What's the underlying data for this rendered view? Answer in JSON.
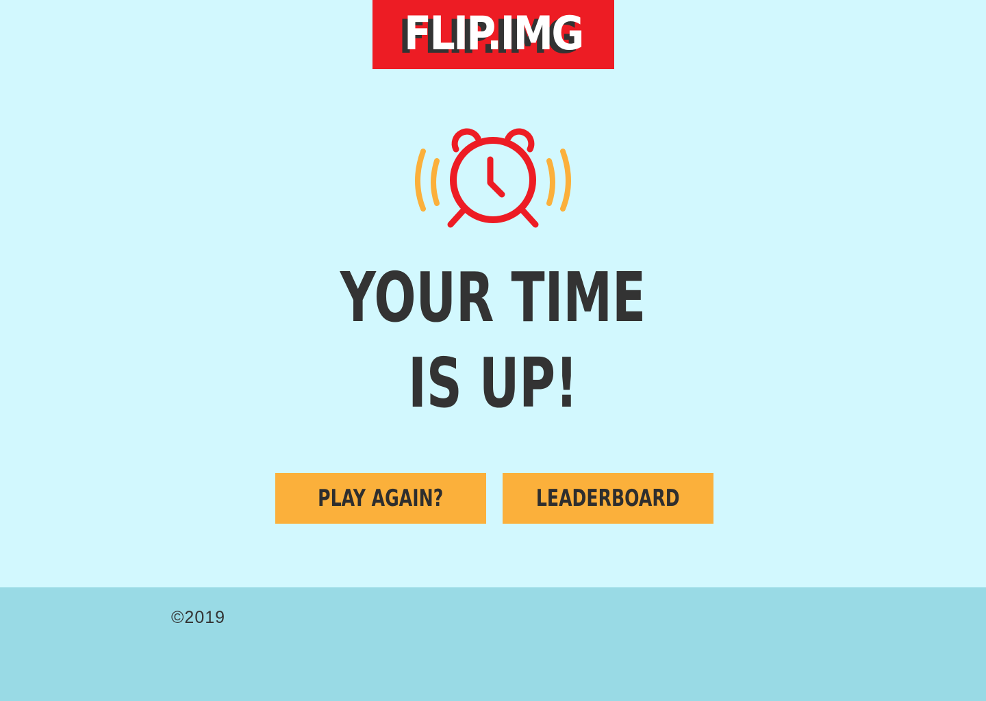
{
  "logo": {
    "text": "FLIP.IMG",
    "background": "#ed1c24"
  },
  "alarm": {
    "icon": "alarm-clock-icon",
    "clock_color": "#ed1c24",
    "ring_color": "#fbb03b"
  },
  "headline": {
    "line1": "YOUR TIME",
    "line2": "IS UP!"
  },
  "buttons": {
    "play_again": "PLAY AGAIN?",
    "leaderboard": "LEADERBOARD",
    "color": "#fbb03b"
  },
  "footer": {
    "copyright": "©2019",
    "background": "#99dae5"
  },
  "page_background": "#d2f8fe"
}
